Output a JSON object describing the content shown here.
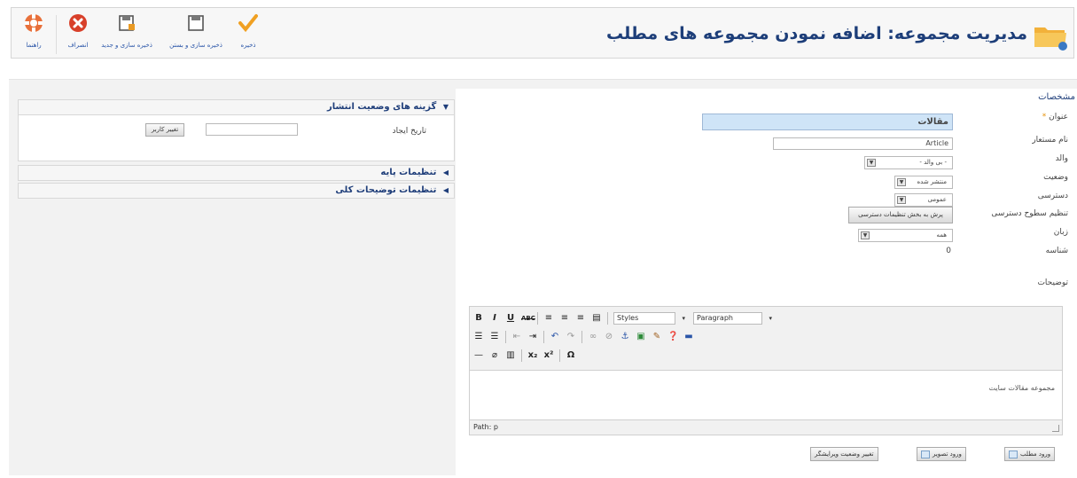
{
  "toolbar": {
    "help_label": "راهنما",
    "cancel_label": "انصراف",
    "save_new_label": "ذخیره سازی و جدید",
    "save_close_label": "ذخیره سازی و بستن",
    "save_label": "ذخیره"
  },
  "page": {
    "title": "مدیریت مجموعه: اضافه نمودن مجموعه های مطلب"
  },
  "sidebar": {
    "publishing_header": "گزینه های وضعیت انتشار",
    "created_date_label": "تاریخ ایجاد",
    "created_date_value": "",
    "change_user_button": "تغییر کاربر",
    "basic_options_header": "تنظیمات پایه",
    "metadata_header": "تنظیمات توضیحات کلی"
  },
  "details": {
    "legend": "مشخصات",
    "title_label": "عنوان",
    "title_required_marker": "*",
    "title_value": "مقالات",
    "alias_label": "نام مستعار",
    "alias_value": "Article",
    "parent_label": "والد",
    "parent_value": "- بی والد -",
    "status_label": "وضعیت",
    "status_value": "منتشر شده",
    "access_label": "دسترسی",
    "access_value": "عمومی",
    "permissions_label": "تنظیم سطوح دسترسی",
    "permissions_button": "پرش به بخش تنظیمات دسترسی",
    "language_label": "زبان",
    "language_value": "همه",
    "id_label": "شناسه",
    "id_value": "0",
    "description_label": "توضیحات"
  },
  "editor": {
    "styles_select": "Styles",
    "format_select": "Paragraph",
    "content": "مجموعه مقالات سایت",
    "path": "Path: p"
  },
  "editor_buttons": {
    "article": "ورود مطلب",
    "image": "ورود تصویر",
    "toggle": "تغییر وضعیت ویرایشگر"
  }
}
